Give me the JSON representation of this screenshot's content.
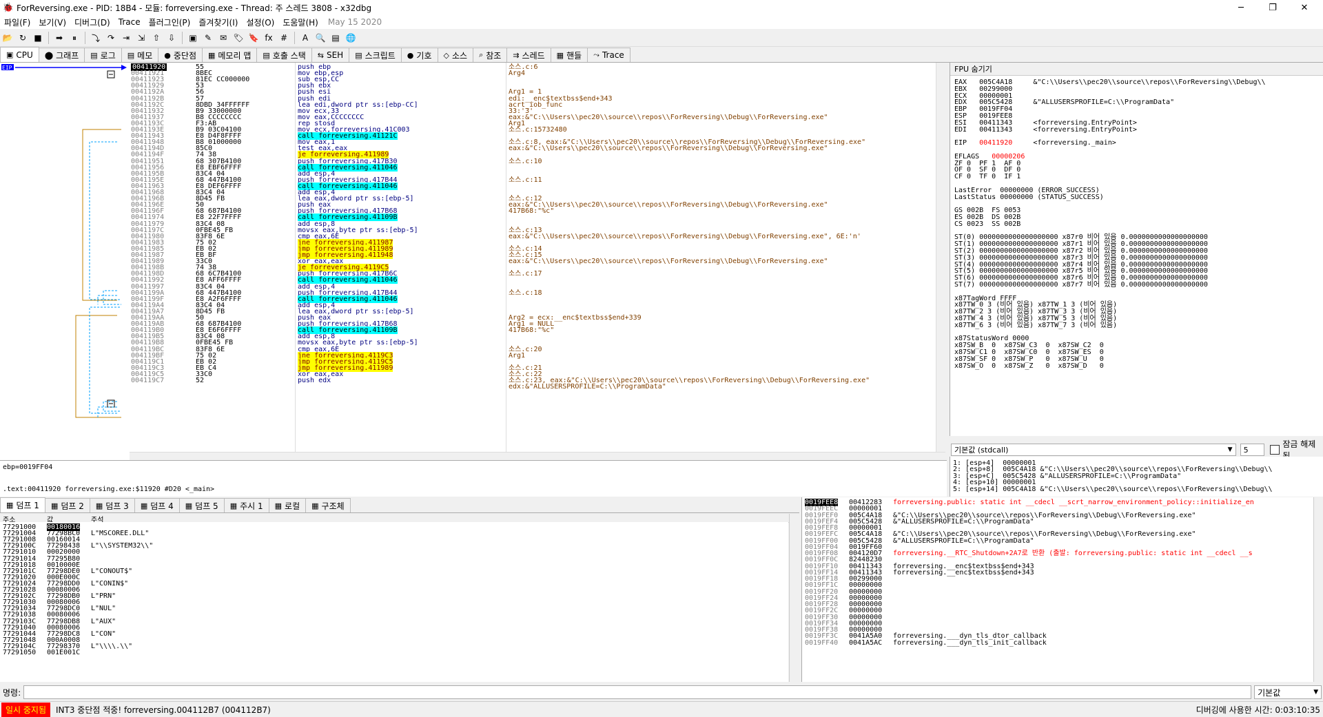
{
  "window": {
    "title": "ForReversing.exe - PID: 18B4 - 모듈: forreversing.exe - Thread: 주 스레드 3808 - x32dbg",
    "minimize": "─",
    "maximize": "❐",
    "close": "✕"
  },
  "menu": {
    "items": [
      "파일(F)",
      "보기(V)",
      "디버그(D)",
      "Trace",
      "플러그인(P)",
      "즐겨찾기(I)",
      "설정(O)",
      "도움말(H)"
    ],
    "date": "May 15 2020"
  },
  "toolbar": {
    "icons": [
      "open-icon",
      "restart-icon",
      "stop-icon",
      "run-icon",
      "pause-icon",
      "step-into-icon",
      "step-over-icon",
      "trace-into-icon",
      "trace-over-icon",
      "run-to-user-icon",
      "execute-till-return-icon",
      "scylla-icon",
      "patch-icon",
      "comment-icon",
      "label-icon",
      "bookmark-icon",
      "function-icon",
      "hash-icon",
      "font-icon",
      "strings-icon",
      "calc-icon",
      "about-icon"
    ],
    "glyphs": [
      "📂",
      "↻",
      "■",
      "➡",
      "⏸",
      "⤵",
      "↷",
      "⇥",
      "⇲",
      "⇧",
      "⇩",
      "▣",
      "✎",
      "✉",
      "🏷",
      "🔖",
      "fx",
      "#",
      "A",
      "🔍",
      "▤",
      "🌐"
    ]
  },
  "tabs": [
    {
      "label": "CPU",
      "icon": "cpu-icon",
      "glyph": "▣"
    },
    {
      "label": "그래프",
      "icon": "graph-icon",
      "glyph": "⬤"
    },
    {
      "label": "로그",
      "icon": "log-icon",
      "glyph": "▤"
    },
    {
      "label": "메모",
      "icon": "notes-icon",
      "glyph": "▤"
    },
    {
      "label": "중단점",
      "icon": "breakpoint-icon",
      "glyph": "●"
    },
    {
      "label": "메모리 맵",
      "icon": "memory-map-icon",
      "glyph": "▦"
    },
    {
      "label": "호출 스택",
      "icon": "call-stack-icon",
      "glyph": "▤"
    },
    {
      "label": "SEH",
      "icon": "seh-icon",
      "glyph": "⇆"
    },
    {
      "label": "스크립트",
      "icon": "script-icon",
      "glyph": "▤"
    },
    {
      "label": "기호",
      "icon": "symbols-icon",
      "glyph": "●"
    },
    {
      "label": "소스",
      "icon": "source-icon",
      "glyph": "◇"
    },
    {
      "label": "참조",
      "icon": "references-icon",
      "glyph": "⌕"
    },
    {
      "label": "스레드",
      "icon": "threads-icon",
      "glyph": "⇉"
    },
    {
      "label": "핸들",
      "icon": "handles-icon",
      "glyph": "▦"
    },
    {
      "label": "Trace",
      "icon": "trace-icon",
      "glyph": "⤳"
    }
  ],
  "disasm": {
    "eip_label": "EIP",
    "rows": [
      {
        "addr": "00411920",
        "bytes": "55",
        "instr": "push ebp",
        "type": "normal",
        "comment": "소스.c:6",
        "cur": true
      },
      {
        "addr": "00411921",
        "bytes": "8BEC",
        "instr": "mov ebp,esp",
        "type": "normal",
        "comment": "Arg4"
      },
      {
        "addr": "00411923",
        "bytes": "81EC CC000000",
        "instr": "sub esp,CC",
        "type": "normal",
        "comment": ""
      },
      {
        "addr": "00411929",
        "bytes": "53",
        "instr": "push ebx",
        "type": "normal",
        "comment": ""
      },
      {
        "addr": "0041192A",
        "bytes": "56",
        "instr": "push esi",
        "type": "normal",
        "comment": "Arg1 = 1"
      },
      {
        "addr": "0041192B",
        "bytes": "57",
        "instr": "push edi",
        "type": "normal",
        "comment": "edi:__enc$textbss$end+343"
      },
      {
        "addr": "0041192C",
        "bytes": "8DBD 34FFFFFF",
        "instr": "lea edi,dword ptr ss:[ebp-CC]",
        "type": "normal",
        "comment": "acrt_iob_func"
      },
      {
        "addr": "00411932",
        "bytes": "B9 33000000",
        "instr": "mov ecx,33",
        "type": "normal",
        "comment": "33:'3'"
      },
      {
        "addr": "00411937",
        "bytes": "B8 CCCCCCCC",
        "instr": "mov eax,CCCCCCCC",
        "type": "normal",
        "comment": "eax:&\"C:\\\\Users\\\\pec20\\\\source\\\\repos\\\\ForReversing\\\\Debug\\\\ForReversing.exe\""
      },
      {
        "addr": "0041193C",
        "bytes": "F3:AB",
        "instr": "rep stosd",
        "type": "normal",
        "comment": "Arg1"
      },
      {
        "addr": "0041193E",
        "bytes": "B9 03C04100",
        "instr": "mov ecx,forreversing.41C003",
        "type": "normal",
        "comment": "소스.c:15732480"
      },
      {
        "addr": "00411943",
        "bytes": "E8 D4F8FFFF",
        "instr": "call forreversing.41121C",
        "type": "call",
        "comment": ""
      },
      {
        "addr": "00411948",
        "bytes": "B8 01000000",
        "instr": "mov eax,1",
        "type": "normal",
        "comment": "소스.c:8, eax:&\"C:\\\\Users\\\\pec20\\\\source\\\\repos\\\\ForReversing\\\\Debug\\\\ForReversing.exe\""
      },
      {
        "addr": "0041194D",
        "bytes": "85C0",
        "instr": "test eax,eax",
        "type": "normal",
        "comment": "eax:&\"C:\\\\Users\\\\pec20\\\\source\\\\repos\\\\ForReversing\\\\Debug\\\\ForReversing.exe\""
      },
      {
        "addr": "0041194F",
        "bytes": "74 38",
        "instr": "je forreversing.411989",
        "type": "jmp",
        "comment": ""
      },
      {
        "addr": "00411951",
        "bytes": "68 307B4100",
        "instr": "push forreversing.417B30",
        "type": "normal",
        "comment": "소스.c:10"
      },
      {
        "addr": "00411956",
        "bytes": "E8 EBF6FFFF",
        "instr": "call forreversing.411046",
        "type": "call",
        "comment": ""
      },
      {
        "addr": "0041195B",
        "bytes": "83C4 04",
        "instr": "add esp,4",
        "type": "normal",
        "comment": ""
      },
      {
        "addr": "0041195E",
        "bytes": "68 447B4100",
        "instr": "push forreversing.417B44",
        "type": "normal",
        "comment": "소스.c:11"
      },
      {
        "addr": "00411963",
        "bytes": "E8 DEF6FFFF",
        "instr": "call forreversing.411046",
        "type": "call",
        "comment": ""
      },
      {
        "addr": "00411968",
        "bytes": "83C4 04",
        "instr": "add esp,4",
        "type": "normal",
        "comment": ""
      },
      {
        "addr": "0041196B",
        "bytes": "8D45 FB",
        "instr": "lea eax,dword ptr ss:[ebp-5]",
        "type": "normal",
        "comment": "소스.c:12"
      },
      {
        "addr": "0041196E",
        "bytes": "50",
        "instr": "push eax",
        "type": "normal",
        "comment": "eax:&\"C:\\\\Users\\\\pec20\\\\source\\\\repos\\\\ForReversing\\\\Debug\\\\ForReversing.exe\""
      },
      {
        "addr": "0041196F",
        "bytes": "68 687B4100",
        "instr": "push forreversing.417B68",
        "type": "normal",
        "comment": "417B68:\"%c\""
      },
      {
        "addr": "00411974",
        "bytes": "E8 22F7FFFF",
        "instr": "call forreversing.41109B",
        "type": "call",
        "comment": ""
      },
      {
        "addr": "00411979",
        "bytes": "83C4 08",
        "instr": "add esp,8",
        "type": "normal",
        "comment": ""
      },
      {
        "addr": "0041197C",
        "bytes": "0FBE45 FB",
        "instr": "movsx eax,byte ptr ss:[ebp-5]",
        "type": "normal",
        "comment": "소스.c:13"
      },
      {
        "addr": "00411980",
        "bytes": "83F8 6E",
        "instr": "cmp eax,6E",
        "type": "normal",
        "comment": "eax:&\"C:\\\\Users\\\\pec20\\\\source\\\\repos\\\\ForReversing\\\\Debug\\\\ForReversing.exe\", 6E:'n'"
      },
      {
        "addr": "00411983",
        "bytes": "75 02",
        "instr": "jne forreversing.411987",
        "type": "jmp",
        "comment": ""
      },
      {
        "addr": "00411985",
        "bytes": "EB 02",
        "instr": "jmp forreversing.411989",
        "type": "jmp",
        "comment": "소스.c:14"
      },
      {
        "addr": "00411987",
        "bytes": "EB BF",
        "instr": "jmp forreversing.411948",
        "type": "jmp",
        "comment": "소스.c:15"
      },
      {
        "addr": "00411989",
        "bytes": "33C0",
        "instr": "xor eax,eax",
        "type": "normal",
        "comment": "eax:&\"C:\\\\Users\\\\pec20\\\\source\\\\repos\\\\ForReversing\\\\Debug\\\\ForReversing.exe\""
      },
      {
        "addr": "0041198B",
        "bytes": "74 38",
        "instr": "je forreversing.4119C5",
        "type": "jmp",
        "comment": ""
      },
      {
        "addr": "0041198D",
        "bytes": "68 6C7B4100",
        "instr": "push forreversing.417B6C",
        "type": "normal",
        "comment": "소스.c:17"
      },
      {
        "addr": "00411992",
        "bytes": "E8 AFF6FFFF",
        "instr": "call forreversing.411046",
        "type": "call",
        "comment": ""
      },
      {
        "addr": "00411997",
        "bytes": "83C4 04",
        "instr": "add esp,4",
        "type": "normal",
        "comment": ""
      },
      {
        "addr": "0041199A",
        "bytes": "68 447B4100",
        "instr": "push forreversing.417B44",
        "type": "normal",
        "comment": "소스.c:18"
      },
      {
        "addr": "0041199F",
        "bytes": "E8 A2F6FFFF",
        "instr": "call forreversing.411046",
        "type": "call",
        "comment": ""
      },
      {
        "addr": "004119A4",
        "bytes": "83C4 04",
        "instr": "add esp,4",
        "type": "normal",
        "comment": ""
      },
      {
        "addr": "004119A7",
        "bytes": "8D45 FB",
        "instr": "lea eax,dword ptr ss:[ebp-5]",
        "type": "normal",
        "comment": ""
      },
      {
        "addr": "004119AA",
        "bytes": "50",
        "instr": "push eax",
        "type": "normal",
        "comment": "Arg2 = ecx:__enc$textbss$end+339"
      },
      {
        "addr": "004119AB",
        "bytes": "68 687B4100",
        "instr": "push forreversing.417B68",
        "type": "normal",
        "comment": "Arg1 = NULL"
      },
      {
        "addr": "004119B0",
        "bytes": "E8 E6F6FFFF",
        "instr": "call forreversing.41109B",
        "type": "call",
        "comment": "417B68:\"%c\""
      },
      {
        "addr": "004119B5",
        "bytes": "83C4 08",
        "instr": "add esp,8",
        "type": "normal",
        "comment": ""
      },
      {
        "addr": "004119B8",
        "bytes": "0FBE45 FB",
        "instr": "movsx eax,byte ptr ss:[ebp-5]",
        "type": "normal",
        "comment": ""
      },
      {
        "addr": "004119BC",
        "bytes": "83F8 6E",
        "instr": "cmp eax,6E",
        "type": "normal",
        "comment": "소스.c:20"
      },
      {
        "addr": "004119BF",
        "bytes": "75 02",
        "instr": "jne forreversing.4119C3",
        "type": "jmp",
        "comment": "Arg1"
      },
      {
        "addr": "004119C1",
        "bytes": "EB 02",
        "instr": "jmp forreversing.4119C5",
        "type": "jmp",
        "comment": ""
      },
      {
        "addr": "004119C3",
        "bytes": "EB C4",
        "instr": "jmp forreversing.411989",
        "type": "jmp",
        "comment": "소스.c:21"
      },
      {
        "addr": "004119C5",
        "bytes": "33C0",
        "instr": "xor eax,eax",
        "type": "normal",
        "comment": "소스.c:22"
      },
      {
        "addr": "004119C7",
        "bytes": "52",
        "instr": "push edx",
        "type": "normal",
        "comment": "소스.c:23, eax:&\"C:\\\\Users\\\\pec20\\\\source\\\\repos\\\\ForReversing\\\\Debug\\\\ForReversing.exe\""
      },
      {
        "addr": "",
        "bytes": "",
        "instr": "",
        "type": "normal",
        "comment": "edx:&\"ALLUSERSPROFILE=C:\\\\ProgramData\""
      }
    ]
  },
  "info": {
    "line1": "ebp=0019FF04",
    "line2": ".text:00411920 forreversing.exe:$11920 #D20 <_main>"
  },
  "registers": {
    "header": "FPU 숨기기",
    "lines": [
      {
        "t": "EAX   005C4A18     &\"C:\\\\Users\\\\pec20\\\\source\\\\repos\\\\ForReversing\\\\Debug\\\\"
      },
      {
        "t": "EBX   00299000"
      },
      {
        "t": "ECX   00000001"
      },
      {
        "t": "EDX   005C5428     &\"ALLUSERSPROFILE=C:\\\\ProgramData\""
      },
      {
        "t": "EBP   0019FF04"
      },
      {
        "t": "ESP   0019FEE8"
      },
      {
        "t": "ESI   00411343     <forreversing.EntryPoint>"
      },
      {
        "t": "EDI   00411343     <forreversing.EntryPoint>"
      },
      {
        "t": ""
      },
      {
        "t": "EIP   00411920     <forreversing._main>",
        "red": true
      },
      {
        "t": ""
      },
      {
        "t": "EFLAGS   00000206",
        "red": true
      },
      {
        "t": "ZF 0  PF 1  AF 0"
      },
      {
        "t": "OF 0  SF 0  DF 0"
      },
      {
        "t": "CF 0  TF 0  IF 1"
      },
      {
        "t": ""
      },
      {
        "t": "LastError  00000000 (ERROR_SUCCESS)"
      },
      {
        "t": "LastStatus 00000000 (STATUS_SUCCESS)"
      },
      {
        "t": ""
      },
      {
        "t": "GS 002B  FS 0053"
      },
      {
        "t": "ES 002B  DS 002B"
      },
      {
        "t": "CS 0023  SS 002B"
      },
      {
        "t": ""
      },
      {
        "t": "ST(0) 0000000000000000000 x87r0 비어 있음 0.0000000000000000000"
      },
      {
        "t": "ST(1) 0000000000000000000 x87r1 비어 있음 0.0000000000000000000"
      },
      {
        "t": "ST(2) 0000000000000000000 x87r2 비어 있음 0.0000000000000000000"
      },
      {
        "t": "ST(3) 0000000000000000000 x87r3 비어 있음 0.0000000000000000000"
      },
      {
        "t": "ST(4) 0000000000000000000 x87r4 비어 있음 0.0000000000000000000"
      },
      {
        "t": "ST(5) 0000000000000000000 x87r5 비어 있음 0.0000000000000000000"
      },
      {
        "t": "ST(6) 0000000000000000000 x87r6 비어 있음 0.0000000000000000000"
      },
      {
        "t": "ST(7) 0000000000000000000 x87r7 비어 있음 0.0000000000000000000"
      },
      {
        "t": ""
      },
      {
        "t": "x87TagWord FFFF"
      },
      {
        "t": "x87TW_0 3 (비어 있음) x87TW_1 3 (비어 있음)"
      },
      {
        "t": "x87TW_2 3 (비어 있음) x87TW_3 3 (비어 있음)"
      },
      {
        "t": "x87TW_4 3 (비어 있음) x87TW_5 3 (비어 있음)"
      },
      {
        "t": "x87TW_6 3 (비어 있음) x87TW_7 3 (비어 있음)"
      },
      {
        "t": ""
      },
      {
        "t": "x87StatusWord 0000"
      },
      {
        "t": "x87SW_B  0  x87SW_C3  0  x87SW_C2  0"
      },
      {
        "t": "x87SW_C1 0  x87SW_C0  0  x87SW_ES  0"
      },
      {
        "t": "x87SW_SF 0  x87SW_P   0  x87SW_U   0"
      },
      {
        "t": "x87SW_O  0  x87SW_Z   0  x87SW_D   0"
      }
    ]
  },
  "callconv": {
    "value": "기본값 (stdcall)",
    "count": "5",
    "unlock": "잠금 해제됨"
  },
  "args": [
    "1: [esp+4]  00000001",
    "2: [esp+8]  005C4A18 &\"C:\\\\Users\\\\pec20\\\\source\\\\repos\\\\ForReversing\\\\Debug\\\\",
    "3: [esp+C]  005C5428 &\"ALLUSERSPROFILE=C:\\\\ProgramData\"",
    "4: [esp+10] 00000001",
    "5: [esp+14] 005C4A18 &\"C:\\\\Users\\\\pec20\\\\source\\\\repos\\\\ForReversing\\\\Debug\\\\"
  ],
  "dumptabs": [
    {
      "label": "덤프 1",
      "icon": "dump-icon"
    },
    {
      "label": "덤프 2",
      "icon": "dump-icon"
    },
    {
      "label": "덤프 3",
      "icon": "dump-icon"
    },
    {
      "label": "덤프 4",
      "icon": "dump-icon"
    },
    {
      "label": "덤프 5",
      "icon": "dump-icon"
    },
    {
      "label": "주시 1",
      "icon": "watch-icon"
    },
    {
      "label": "로컬",
      "icon": "locals-icon"
    },
    {
      "label": "구조체",
      "icon": "struct-icon"
    }
  ],
  "dumpheader": {
    "addr": "주소",
    "val": "값",
    "com": "주석"
  },
  "dump": [
    {
      "a": "77291000",
      "v": "00180016",
      "c": ""
    },
    {
      "a": "77291004",
      "v": "77298BC0",
      "c": "L\"MSCOREE.DLL\""
    },
    {
      "a": "77291008",
      "v": "00160014",
      "c": ""
    },
    {
      "a": "7729100C",
      "v": "77298438",
      "c": "L\"\\\\SYSTEM32\\\\\""
    },
    {
      "a": "77291010",
      "v": "00020000",
      "c": ""
    },
    {
      "a": "77291014",
      "v": "77295B80",
      "c": ""
    },
    {
      "a": "77291018",
      "v": "0010000E",
      "c": ""
    },
    {
      "a": "7729101C",
      "v": "77298DE0",
      "c": "L\"CONOUT$\""
    },
    {
      "a": "77291020",
      "v": "000E000C",
      "c": ""
    },
    {
      "a": "77291024",
      "v": "77298DD0",
      "c": "L\"CONIN$\""
    },
    {
      "a": "77291028",
      "v": "00080006",
      "c": ""
    },
    {
      "a": "7729102C",
      "v": "77298DB0",
      "c": "L\"PRN\""
    },
    {
      "a": "77291030",
      "v": "00080006",
      "c": ""
    },
    {
      "a": "77291034",
      "v": "77298DC0",
      "c": "L\"NUL\""
    },
    {
      "a": "77291038",
      "v": "00080006",
      "c": ""
    },
    {
      "a": "7729103C",
      "v": "77298DB8",
      "c": "L\"AUX\""
    },
    {
      "a": "77291040",
      "v": "00080006",
      "c": ""
    },
    {
      "a": "77291044",
      "v": "77298DC8",
      "c": "L\"CON\""
    },
    {
      "a": "77291048",
      "v": "000A0008",
      "c": ""
    },
    {
      "a": "7729104C",
      "v": "77298370",
      "c": "L\"\\\\\\\\.\\\\\""
    },
    {
      "a": "77291050",
      "v": "001E001C",
      "c": ""
    }
  ],
  "stack": [
    {
      "a": "0019FEE8",
      "v": "00412283",
      "c": "forreversing.public: static int __cdecl __scrt_narrow_environment_policy::initialize_en",
      "cur": true,
      "red": true
    },
    {
      "a": "0019FEEC",
      "v": "00000001",
      "c": ""
    },
    {
      "a": "0019FEF0",
      "v": "005C4A18",
      "c": "&\"C:\\\\Users\\\\pec20\\\\source\\\\repos\\\\ForReversing\\\\Debug\\\\ForReversing.exe\""
    },
    {
      "a": "0019FEF4",
      "v": "005C5428",
      "c": "&\"ALLUSERSPROFILE=C:\\\\ProgramData\""
    },
    {
      "a": "0019FEF8",
      "v": "00000001",
      "c": ""
    },
    {
      "a": "0019FEFC",
      "v": "005C4A18",
      "c": "&\"C:\\\\Users\\\\pec20\\\\source\\\\repos\\\\ForReversing\\\\Debug\\\\ForReversing.exe\""
    },
    {
      "a": "0019FF00",
      "v": "005C5428",
      "c": "&\"ALLUSERSPROFILE=C:\\\\ProgramData\""
    },
    {
      "a": "0019FF04",
      "v": "0019FF60",
      "c": ""
    },
    {
      "a": "0019FF08",
      "v": "004120D7",
      "c": "forreversing.__RTC_Shutdown+2A7로 반환 (출발: forreversing.public: static int __cdecl __s",
      "red": true
    },
    {
      "a": "0019FF0C",
      "v": "82448230",
      "c": ""
    },
    {
      "a": "0019FF10",
      "v": "00411343",
      "c": "forreversing.__enc$textbss$end+343"
    },
    {
      "a": "0019FF14",
      "v": "00411343",
      "c": "forreversing.__enc$textbss$end+343"
    },
    {
      "a": "0019FF18",
      "v": "00299000",
      "c": ""
    },
    {
      "a": "0019FF1C",
      "v": "00000000",
      "c": ""
    },
    {
      "a": "0019FF20",
      "v": "00000000",
      "c": ""
    },
    {
      "a": "0019FF24",
      "v": "00000000",
      "c": ""
    },
    {
      "a": "0019FF28",
      "v": "00000000",
      "c": ""
    },
    {
      "a": "0019FF2C",
      "v": "00000000",
      "c": ""
    },
    {
      "a": "0019FF30",
      "v": "00000000",
      "c": ""
    },
    {
      "a": "0019FF34",
      "v": "00000000",
      "c": ""
    },
    {
      "a": "0019FF38",
      "v": "00000000",
      "c": ""
    },
    {
      "a": "0019FF3C",
      "v": "0041A5A0",
      "c": "forreversing.___dyn_tls_dtor_callback"
    },
    {
      "a": "0019FF40",
      "v": "0041A5AC",
      "c": "forreversing.___dyn_tls_init_callback"
    }
  ],
  "cmd": {
    "label": "명령:",
    "mode": "기본값"
  },
  "status": {
    "state": "일시 중지됨",
    "message": "INT3 중단점 적중! forreversing.004112B7 (004112B7)",
    "time": "디버깅에 사용한 시간: 0:03:10:35"
  }
}
